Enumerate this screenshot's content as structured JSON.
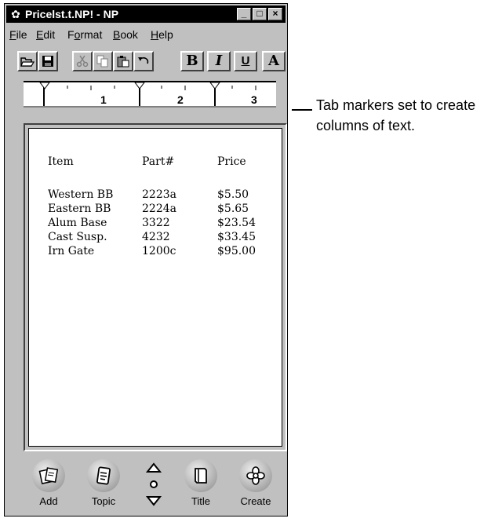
{
  "window": {
    "title": "Pricelst.t.NP! - NP",
    "controls": {
      "minimize": "_",
      "maximize": "□",
      "close": "×"
    }
  },
  "menu": [
    {
      "label": "File",
      "mnemonic": "F",
      "rest": "ile"
    },
    {
      "label": "Edit",
      "mnemonic": "E",
      "rest": "dit"
    },
    {
      "label": "Format",
      "mnemonic": "o",
      "pre": "F",
      "rest": "rmat"
    },
    {
      "label": "Book",
      "mnemonic": "B",
      "rest": "ook"
    },
    {
      "label": "Help",
      "mnemonic": "H",
      "rest": "elp"
    }
  ],
  "toolbar": {
    "bold": "B",
    "italic": "I",
    "underline": "U",
    "font": "A",
    "icons": [
      "open-folder-icon",
      "save-disk-icon",
      "cut-icon",
      "copy-icon",
      "paste-icon",
      "undo-icon"
    ]
  },
  "ruler": {
    "marks": [
      "1",
      "2",
      "3"
    ]
  },
  "table": {
    "headers": [
      "Item",
      "Part#",
      "Price"
    ],
    "rows": [
      [
        "Western BB",
        "2223a",
        "$5.50"
      ],
      [
        "Eastern BB",
        "2224a",
        "$5.65"
      ],
      [
        "Alum Base",
        "3322",
        "$23.54"
      ],
      [
        "Cast Susp.",
        "4232",
        "$33.45"
      ],
      [
        "Irn Gate",
        "1200c",
        "$95.00"
      ]
    ]
  },
  "bottom_nav": {
    "add": "Add",
    "topic": "Topic",
    "title": "Title",
    "create": "Create"
  },
  "callout": {
    "line1": "Tab markers set to create",
    "line2": "columns of text."
  }
}
